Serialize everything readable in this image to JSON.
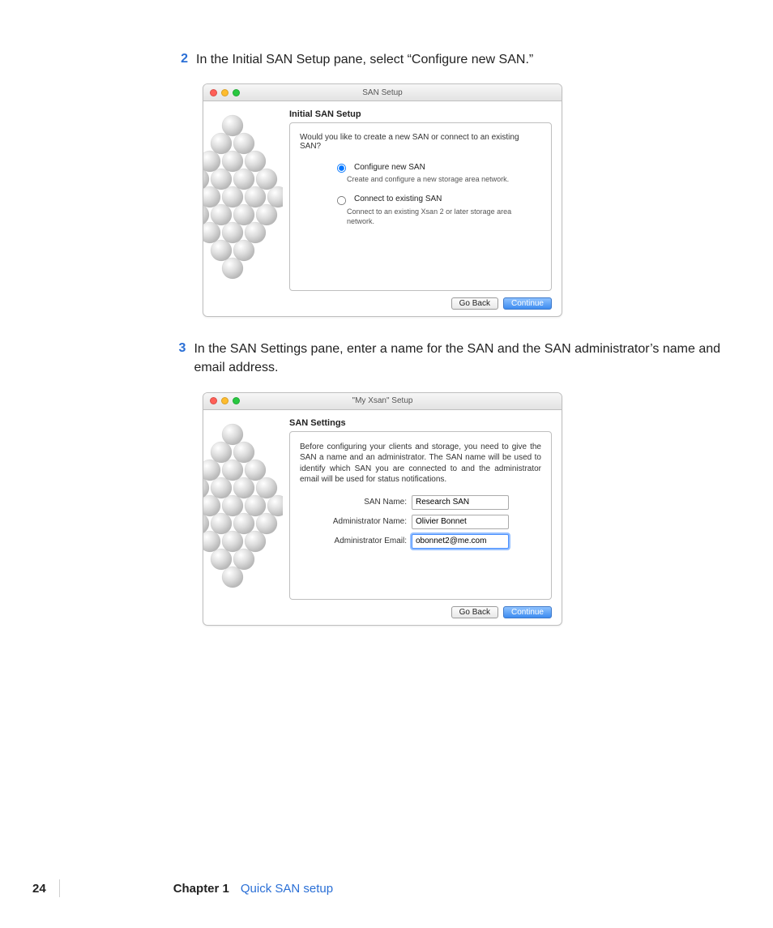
{
  "steps": {
    "s2": {
      "num": "2",
      "text": "In the Initial SAN Setup pane, select “Configure new SAN.”"
    },
    "s3": {
      "num": "3",
      "text": "In the SAN Settings pane, enter a name for the SAN and the SAN administrator’s name and email address."
    }
  },
  "window1": {
    "title": "SAN Setup",
    "heading": "Initial SAN Setup",
    "intro": "Would you like to create a new SAN or connect to an existing SAN?",
    "opt1": {
      "label": "Configure new SAN",
      "desc": "Create and configure a new storage area network."
    },
    "opt2": {
      "label": "Connect to existing SAN",
      "desc": "Connect to an existing Xsan 2 or later storage area network."
    },
    "goback": "Go Back",
    "continue": "Continue"
  },
  "window2": {
    "title": "\"My Xsan\" Setup",
    "heading": "SAN Settings",
    "intro": "Before configuring your clients and storage, you need to give the SAN a name and an administrator. The SAN name will be used to identify which SAN you are connected to and the administrator email will be used for status notifications.",
    "fields": {
      "san_name": {
        "label": "SAN Name:",
        "value": "Research SAN"
      },
      "admin_name": {
        "label": "Administrator Name:",
        "value": "Olivier Bonnet"
      },
      "admin_email": {
        "label": "Administrator Email:",
        "value": "obonnet2@me.com"
      }
    },
    "goback": "Go Back",
    "continue": "Continue"
  },
  "footer": {
    "page": "24",
    "chapter_label": "Chapter 1",
    "chapter_title": "Quick SAN setup"
  }
}
